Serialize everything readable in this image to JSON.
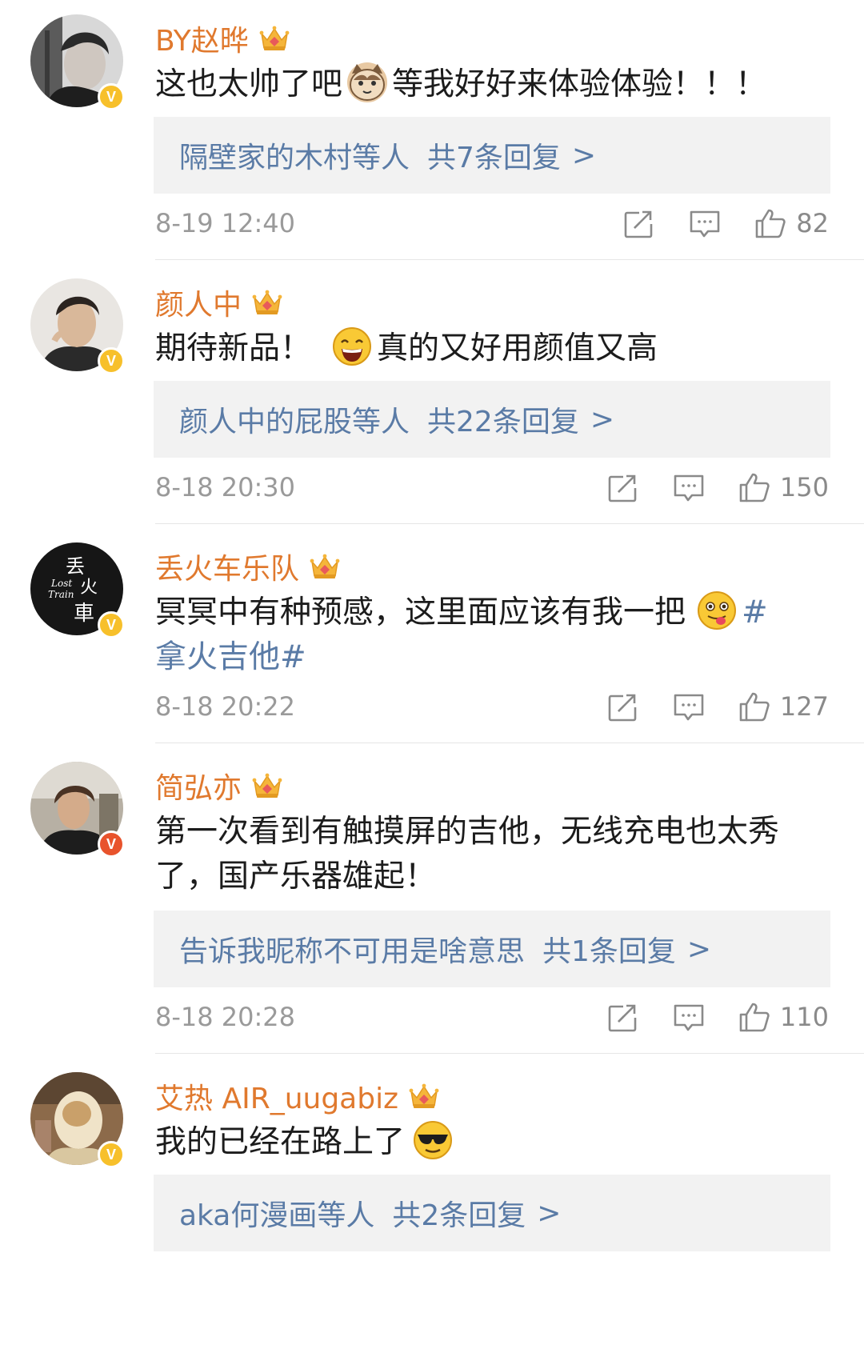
{
  "icons": {
    "share": "share-icon",
    "comment": "comment-icon",
    "like": "thumbs-up-icon",
    "crown": "crown-badge-icon",
    "verified": "verified-v-icon"
  },
  "colors": {
    "username": "#e0792e",
    "link": "#5a7ba6",
    "meta": "#9a9a9a",
    "reply_bg": "#f2f2f2",
    "verified_yellow": "#f7c02b",
    "verified_red": "#e8532c"
  },
  "comments": [
    {
      "username": "BY赵晔",
      "crown_level": "",
      "verified": "yellow",
      "text_before": "这也太帅了吧",
      "emoji": "cat-emoji",
      "text_after": "等我好好来体验体验！！！",
      "reply_users": "隔壁家的木村等人",
      "reply_count": "共7条回复",
      "reply_chevron": ">",
      "time": "8-19 12:40",
      "likes": "82"
    },
    {
      "username": "颜人中",
      "crown_level": "6",
      "verified": "yellow",
      "text_before": "期待新品！",
      "emoji": "grinning-emoji",
      "text_after": "真的又好用颜值又高",
      "reply_users": "颜人中的屁股等人",
      "reply_count": "共22条回复",
      "reply_chevron": ">",
      "time": "8-18 20:30",
      "likes": "150"
    },
    {
      "username": "丢火车乐队",
      "crown_level": "7",
      "verified": "yellow",
      "text_line1_before": "冥冥中有种预感，这里面应该有我一把",
      "emoji": "tongue-emoji",
      "text_line1_tag": "#",
      "text_line2_tag": "拿火吉他#",
      "avatar_logo_line1": "丢",
      "avatar_logo_line2": "火",
      "avatar_logo_line3": "車",
      "avatar_logo_en1": "Lost",
      "avatar_logo_en2": "Train",
      "time": "8-18 20:22",
      "likes": "127"
    },
    {
      "username": "简弘亦",
      "crown_level": "",
      "verified": "red",
      "text_line1": "第一次看到有触摸屏的吉他，无线充电也太秀",
      "text_line2": "了，国产乐器雄起！",
      "reply_users": "告诉我昵称不可用是啥意思",
      "reply_count": "共1条回复",
      "reply_chevron": ">",
      "time": "8-18 20:28",
      "likes": "110"
    },
    {
      "username": "艾热 AIR_uugabiz",
      "crown_level": "6",
      "verified": "yellow",
      "text_before": "我的已经在路上了",
      "emoji": "cool-sunglasses-emoji",
      "reply_users": "aka何漫画等人",
      "reply_count": "共2条回复",
      "reply_chevron": ">"
    }
  ],
  "verified_letter": "V"
}
